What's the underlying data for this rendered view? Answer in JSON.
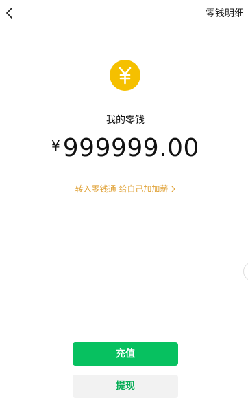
{
  "header": {
    "detail_label": "零钱明细"
  },
  "icons": {
    "back": "chevron-left-icon",
    "coin": "yuan-coin-icon",
    "promo_arrow": "chevron-right-icon"
  },
  "wallet": {
    "title": "我的零钱",
    "currency_symbol": "¥",
    "balance": "999999.00"
  },
  "promo": {
    "text": "转入零钱通 给自己加加薪"
  },
  "actions": {
    "recharge_label": "充值",
    "withdraw_label": "提现"
  },
  "colors": {
    "coin": "#f5c000",
    "promo": "#e0a33a",
    "primary_button": "#07c160",
    "primary_button_text": "#ffffff",
    "secondary_button": "#f2f2f2",
    "secondary_button_text": "#06ad56"
  }
}
